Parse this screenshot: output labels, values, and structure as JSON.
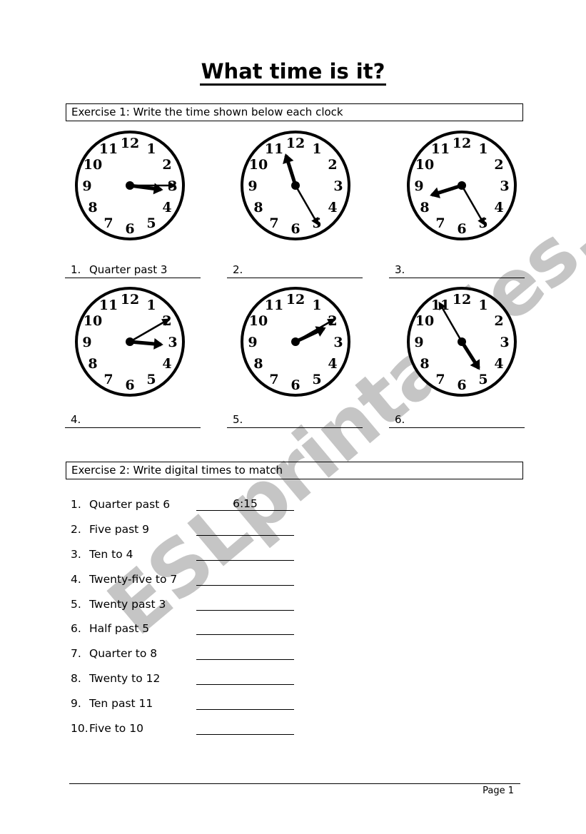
{
  "title": "What time is it?",
  "exercise1": {
    "heading": "Exercise 1: Write the time shown below each clock",
    "clock_numerals": [
      "12",
      "1",
      "2",
      "3",
      "4",
      "5",
      "6",
      "7",
      "8",
      "9",
      "10",
      "11"
    ],
    "clocks": [
      {
        "number": "1.",
        "answer": "Quarter past 3",
        "hour": 3,
        "minute": 15
      },
      {
        "number": "2.",
        "answer": "",
        "hour": 11,
        "minute": 25
      },
      {
        "number": "3.",
        "answer": "",
        "hour": 8,
        "minute": 25
      },
      {
        "number": "4.",
        "answer": "",
        "hour": 3,
        "minute": 10
      },
      {
        "number": "5.",
        "answer": "",
        "hour": 2,
        "minute": 10
      },
      {
        "number": "6.",
        "answer": "",
        "hour": 4,
        "minute": 55
      }
    ]
  },
  "exercise2": {
    "heading": "Exercise 2: Write digital times to match",
    "items": [
      {
        "number": "1.",
        "phrase": "Quarter past 6",
        "answer": "6:15"
      },
      {
        "number": "2.",
        "phrase": "Five past 9",
        "answer": ""
      },
      {
        "number": "3.",
        "phrase": "Ten to 4",
        "answer": ""
      },
      {
        "number": "4.",
        "phrase": "Twenty-five to 7",
        "answer": ""
      },
      {
        "number": "5.",
        "phrase": "Twenty past 3",
        "answer": ""
      },
      {
        "number": "6.",
        "phrase": "Half past 5",
        "answer": ""
      },
      {
        "number": "7.",
        "phrase": "Quarter to 8",
        "answer": ""
      },
      {
        "number": "8.",
        "phrase": "Twenty to 12",
        "answer": ""
      },
      {
        "number": "9.",
        "phrase": "Ten past 11",
        "answer": ""
      },
      {
        "number": "10.",
        "phrase": "Five to 10",
        "answer": ""
      }
    ]
  },
  "footer": {
    "page": "Page 1"
  },
  "watermark": "ESLprintables.com"
}
